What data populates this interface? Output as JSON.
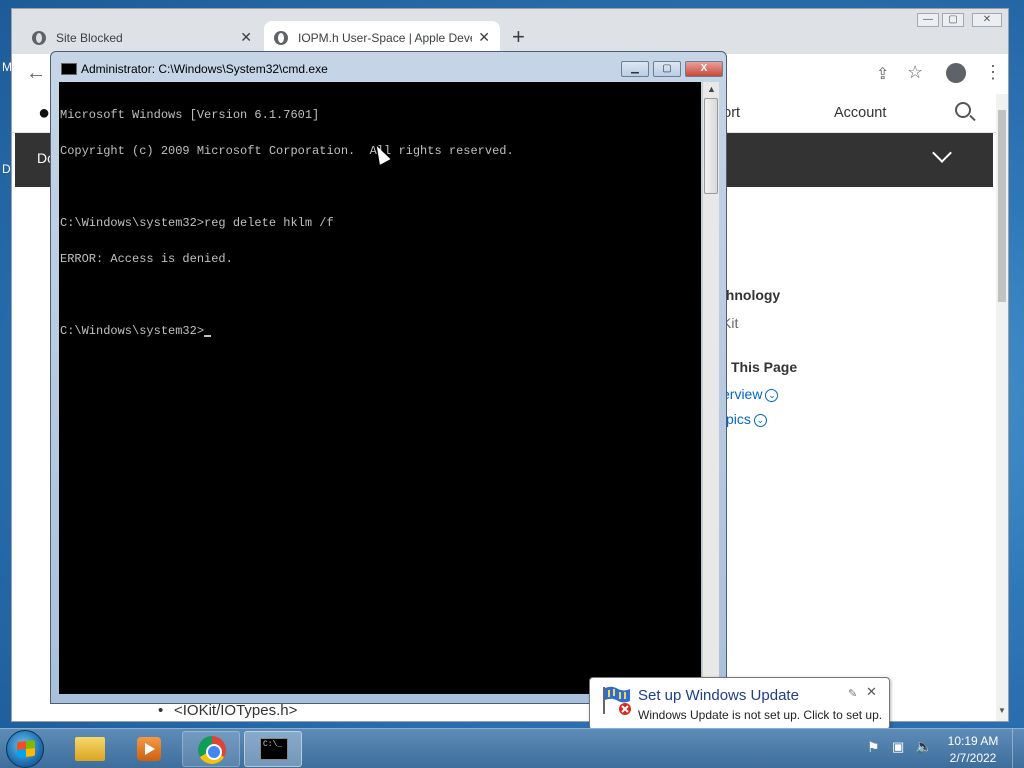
{
  "desktop": {
    "frag_top": "M",
    "frag_bottom": "D"
  },
  "chrome": {
    "tabs": [
      {
        "title": "Site Blocked"
      },
      {
        "title": "IOPM.h User-Space | Apple Deve"
      }
    ],
    "new_tab": "+",
    "back": "←",
    "share": "⇪",
    "star": "☆",
    "menu": "⋮",
    "min": "—",
    "max": "▢",
    "close": "✕",
    "page": {
      "nav_support": "pport",
      "nav_account": "Account",
      "dark_bar_text": "Do",
      "sidebar_tech": "chnology",
      "sidebar_kit": "Kit",
      "on_this_page": "This Page",
      "overview": "erview",
      "topics": "pics",
      "bullet": "<IOKit/IOTypes.h>"
    }
  },
  "cmd": {
    "title": "Administrator: C:\\Windows\\System32\\cmd.exe",
    "lines": [
      "Microsoft Windows [Version 6.1.7601]",
      "Copyright (c) 2009 Microsoft Corporation.  All rights reserved.",
      "",
      "C:\\Windows\\system32>reg delete hklm /f",
      "ERROR: Access is denied.",
      "",
      "C:\\Windows\\system32>"
    ],
    "min": "▁",
    "max": "▢",
    "close": "X"
  },
  "notification": {
    "title": "Set up Windows Update",
    "message": "Windows Update is not set up. Click to set up.",
    "pin": "✎",
    "close": "✕"
  },
  "taskbar": {
    "time": "10:19 AM",
    "date": "2/7/2022",
    "cmd_icon_text": "C:\\_"
  },
  "icons": {
    "chrome_tab": "globe-icon",
    "start": "windows-start-icon",
    "explorer": "folder-icon",
    "media": "media-player-icon",
    "chrome": "chrome-icon",
    "cmd": "cmd-icon",
    "tray_flag": "action-center-flag-icon",
    "tray_net": "network-icon",
    "tray_vol": "volume-icon",
    "balloon": "windows-update-icon"
  },
  "colors": {
    "desktop": "#2f78b8",
    "console_bg": "#000000",
    "console_text": "#c0c0c0",
    "link": "#0066cc",
    "balloon_title": "#1e3d8a"
  }
}
